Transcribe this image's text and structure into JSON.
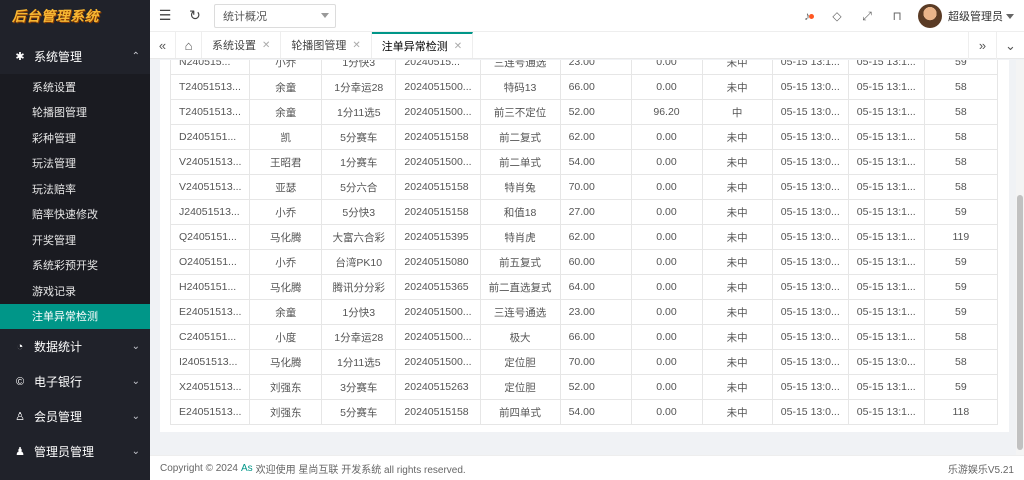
{
  "app": {
    "logo_text": "后台管理系统"
  },
  "sidebar": {
    "sections": [
      {
        "label": "系统管理",
        "icon": "gear-icon",
        "glyph": "✱",
        "open": true,
        "items": [
          "系统设置",
          "轮播图管理",
          "彩种管理",
          "玩法管理",
          "玩法赔率",
          "赔率快速修改",
          "开奖管理",
          "系统彩预开奖",
          "游戏记录",
          "注单异常检测"
        ],
        "active_index": 9
      },
      {
        "label": "数据统计",
        "icon": "dashboard-icon",
        "glyph": "◔"
      },
      {
        "label": "电子银行",
        "icon": "bank-icon",
        "glyph": "©"
      },
      {
        "label": "会员管理",
        "icon": "member-icon",
        "glyph": "♙"
      },
      {
        "label": "管理员管理",
        "icon": "user-icon",
        "glyph": "♟"
      }
    ]
  },
  "header": {
    "select_value": "统计概况",
    "user_name": "超级管理员"
  },
  "tabs": {
    "items": [
      {
        "label": "系统设置",
        "active": false
      },
      {
        "label": "轮播图管理",
        "active": false
      },
      {
        "label": "注单异常检测",
        "active": true
      }
    ]
  },
  "table": {
    "rows": [
      [
        "N240515...",
        "小乔",
        "1分快3",
        "20240515...",
        "三连号通选",
        "23.00",
        "0.00",
        "未中",
        "05-15 13:1...",
        "05-15 13:1...",
        "59"
      ],
      [
        "T24051513...",
        "余童",
        "1分幸运28",
        "2024051500...",
        "特码13",
        "66.00",
        "0.00",
        "未中",
        "05-15 13:0...",
        "05-15 13:1...",
        "58"
      ],
      [
        "T24051513...",
        "余童",
        "1分11选5",
        "2024051500...",
        "前三不定位",
        "52.00",
        "96.20",
        "中",
        "05-15 13:0...",
        "05-15 13:1...",
        "58"
      ],
      [
        "D2405151...",
        "凯",
        "5分赛车",
        "20240515158",
        "前二复式",
        "62.00",
        "0.00",
        "未中",
        "05-15 13:0...",
        "05-15 13:1...",
        "58"
      ],
      [
        "V24051513...",
        "王昭君",
        "1分赛车",
        "2024051500...",
        "前二单式",
        "54.00",
        "0.00",
        "未中",
        "05-15 13:0...",
        "05-15 13:1...",
        "58"
      ],
      [
        "V24051513...",
        "亚瑟",
        "5分六合",
        "20240515158",
        "特肖兔",
        "70.00",
        "0.00",
        "未中",
        "05-15 13:0...",
        "05-15 13:1...",
        "58"
      ],
      [
        "J24051513...",
        "小乔",
        "5分快3",
        "20240515158",
        "和值18",
        "27.00",
        "0.00",
        "未中",
        "05-15 13:0...",
        "05-15 13:1...",
        "59"
      ],
      [
        "Q2405151...",
        "马化腾",
        "大富六合彩",
        "20240515395",
        "特肖虎",
        "62.00",
        "0.00",
        "未中",
        "05-15 13:0...",
        "05-15 13:1...",
        "119"
      ],
      [
        "O2405151...",
        "小乔",
        "台湾PK10",
        "20240515080",
        "前五复式",
        "60.00",
        "0.00",
        "未中",
        "05-15 13:0...",
        "05-15 13:1...",
        "59"
      ],
      [
        "H2405151...",
        "马化腾",
        "腾讯分分彩",
        "20240515365",
        "前二直选复式",
        "64.00",
        "0.00",
        "未中",
        "05-15 13:0...",
        "05-15 13:1...",
        "59"
      ],
      [
        "E24051513...",
        "余童",
        "1分快3",
        "2024051500...",
        "三连号通选",
        "23.00",
        "0.00",
        "未中",
        "05-15 13:0...",
        "05-15 13:1...",
        "59"
      ],
      [
        "C2405151...",
        "小度",
        "1分幸运28",
        "2024051500...",
        "极大",
        "66.00",
        "0.00",
        "未中",
        "05-15 13:0...",
        "05-15 13:1...",
        "58"
      ],
      [
        "I24051513...",
        "马化腾",
        "1分11选5",
        "2024051500...",
        "定位胆",
        "70.00",
        "0.00",
        "未中",
        "05-15 13:0...",
        "05-15 13:0...",
        "58"
      ],
      [
        "X24051513...",
        "刘强东",
        "3分赛车",
        "20240515263",
        "定位胆",
        "52.00",
        "0.00",
        "未中",
        "05-15 13:0...",
        "05-15 13:1...",
        "59"
      ],
      [
        "E24051513...",
        "刘强东",
        "5分赛车",
        "20240515158",
        "前四单式",
        "54.00",
        "0.00",
        "未中",
        "05-15 13:0...",
        "05-15 13:1...",
        "118"
      ]
    ]
  },
  "footer": {
    "prefix": "Copyright © 2024",
    "link": "As",
    "suffix": "欢迎使用 星尚互联 开发系统 all rights reserved.",
    "version": "乐游娱乐V5.21"
  }
}
